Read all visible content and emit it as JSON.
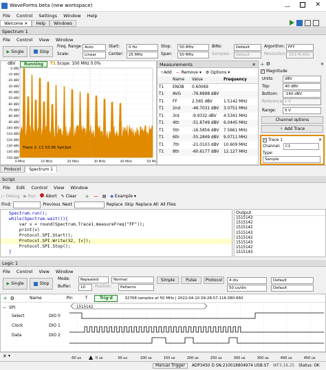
{
  "window": {
    "title": "WaveForms beta (new workspace)"
  },
  "main_menu": [
    "File",
    "Control",
    "Settings",
    "Window",
    "Help"
  ],
  "workspace_tabs": [
    "Welcome",
    "Help",
    "Windows"
  ],
  "spectrum": {
    "panel_title": "Spectrum 1",
    "menu": [
      "File",
      "Control",
      "View",
      "Window"
    ],
    "single_label": "Single",
    "stop_label": "Stop",
    "freq_range_label": "Freq. Range:",
    "freq_range_value": "Auto",
    "scale_label": "Scale:",
    "scale_value": "Linear",
    "start_label": "Start:",
    "start_value": "0 Hz",
    "center_label": "Center:",
    "center_value": "25 MHz",
    "stop2_label": "Stop:",
    "stop2_value": "50 MHz",
    "span_label": "Span:",
    "span_value": "50 MHz",
    "bins_label": "BINs:",
    "bins_value": "Default",
    "samples_label": "Samples:",
    "samples_value": "Default",
    "algorithm_label": "Algorithm:",
    "algorithm_value": "FFT",
    "resolution_label": "Resolution:",
    "resolution_value": ".05176 kHz",
    "plot": {
      "yunit": "dBV",
      "status": "Running",
      "trace": "T1",
      "scope_info": "Scope: 100 MHz 0.0%",
      "cursor_label": "Trace 1: C1 53.96 Vpk2pk",
      "yticks": [
        "0 dBV",
        "-10 dBV",
        "-20 dBV",
        "-30 dBV",
        "-40 dBV",
        "-50 dBV",
        "-60 dBV",
        "-70 dBV",
        "-80 dBV",
        "-90 dBV",
        "-100 dBV",
        "-110 dBV",
        "-120 dBV",
        "-130 dBV",
        "-140 dBV",
        "-150 dBV"
      ],
      "xticks": [
        "0 MHz",
        "10 MHz",
        "20 MHz",
        "30 MHz",
        "40 MHz",
        "50 MHz"
      ]
    },
    "bottom_tabs": [
      "Protocol",
      "Spectrum 1"
    ]
  },
  "measurements": {
    "title": "Measurements",
    "add_label": "Add",
    "remove_label": "Remove",
    "options_label": "Options",
    "columns": [
      "",
      "Name",
      "Value",
      "Frequency"
    ],
    "rows": [
      [
        "T1",
        "ENOB",
        "0.60069",
        ""
      ],
      [
        "T1",
        "AVG",
        "-76.8998 dBV",
        ""
      ],
      [
        "T1",
        "FF",
        "2.565 dBV",
        "1.5142 MHz"
      ],
      [
        "T1",
        "2nd",
        "-46.7031 dBV",
        "3.0751 MHz"
      ],
      [
        "T1",
        "3rd",
        "-9.9332 dBV",
        "4.5341 MHz"
      ],
      [
        "T1",
        "4th",
        "-51.8749 dBV",
        "6.0445 MHz"
      ],
      [
        "T1",
        "5th",
        "-16.5856 dBV",
        "7.5661 MHz"
      ],
      [
        "T1",
        "6th",
        "-55.2849 dBV",
        "9.0711 MHz"
      ],
      [
        "T1",
        "7th",
        "-21.0103 dBV",
        "10.609 MHz"
      ],
      [
        "T1",
        "8th",
        "-60.6177 dBV",
        "12.127 MHz"
      ]
    ]
  },
  "display": {
    "magnitude_label": "Magnitude",
    "units_label": "Units:",
    "units_value": "dBV",
    "top_label": "Top:",
    "top_value": "40 dBV",
    "bottom_label": "Bottom:",
    "bottom_value": "-160 dBV",
    "reference_label": "Reference:",
    "reference_value": "1 V",
    "range_label": "Range:",
    "range_value": "5 V",
    "channel_options_label": "Channel options",
    "add_trace_label": "Add Trace",
    "trace1_label": "Trace 1",
    "channel_label": "Channel:",
    "channel_value": "C1",
    "type_label": "Type:",
    "type_value": "Sample"
  },
  "script": {
    "title": "Script",
    "menu": [
      "File",
      "Edit",
      "Control",
      "View",
      "Window"
    ],
    "debug_label": "Debug",
    "run_label": "Run",
    "abort_label": "Abort",
    "clear_label": "Clear",
    "example_label": "Example",
    "find_label": "Find:",
    "previous_label": "Previous",
    "next_label": "Next",
    "replace_label": "Replace",
    "skip_label": "Skip",
    "replace_all_label": "Replace All",
    "all_files_label": "All Files",
    "code": [
      "Spectrum.run();",
      "while(Spectrum.wait()){",
      "    var v = round(Spectrum.Trace1.measureFreq(\"FF\"));",
      "    print(v)",
      "    Protocol.SPI.Start();",
      "    Protocol.SPI.Write(32, [v]);",
      "    Protocol.SPI.Stop();",
      "}"
    ],
    "output_title": "Output",
    "output_lines": [
      "1515143",
      "1515142",
      "1515142",
      "1515143",
      "1515142",
      "1515143",
      "1515142",
      "1515143"
    ]
  },
  "logic": {
    "title": "Logic 1",
    "menu": [
      "File",
      "Control",
      "View",
      "Window"
    ],
    "single_label": "Single",
    "stop_label": "Stop",
    "mode_label": "Mode:",
    "mode_value": "Repeated",
    "mode2_value": "Normal",
    "buffer_label": "Buffer:",
    "buffer_value": "10",
    "position_label": "Position:",
    "position_value": "0 s",
    "patterns_label": "Patterns",
    "simple_label": "Simple",
    "pulse_label": "Pulse",
    "protocol_label": "Protocol",
    "div_value": "4 div",
    "default_value": "Default",
    "rate_value": "50 us/div",
    "default2_value": "Default",
    "status": "Trig'd",
    "info": "32768 samples at 50 MHz | 2022-04-10 09:28:57.116.080.660",
    "columns": [
      "Name",
      "Pin",
      "T"
    ],
    "rows": [
      {
        "name": "SPI",
        "pin": "",
        "data": "1515142"
      },
      {
        "name": "Select",
        "pin": "DIO 0"
      },
      {
        "name": "Clock",
        "pin": "DIO 1"
      },
      {
        "name": "Data",
        "pin": "DIO 2"
      }
    ],
    "xticks": [
      "-50 us",
      "0 us",
      "50 us",
      "100 us",
      "150 us",
      "200 us",
      "250 us",
      "300 us",
      "350 us",
      "400 us",
      "450 us"
    ]
  },
  "statusbar": {
    "manual_trigger": "Manual Trigger",
    "device": "ADP3450 D SN:210018804974 USB:ST",
    "version": "WF3.18.25",
    "status": "Status: OK"
  }
}
